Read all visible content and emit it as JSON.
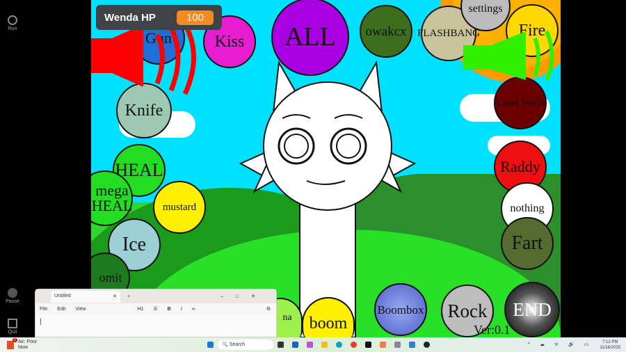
{
  "sidebar": {
    "run": "Run",
    "pause": "Pause",
    "quit": "Quit"
  },
  "hud": {
    "name": "Wenda HP",
    "hp": "100"
  },
  "buttons": [
    "Gun",
    "Kiss",
    "ALL",
    "owakcx",
    "FLASHBANG",
    "settings",
    "Fire",
    "Laser beam",
    "Knife",
    "HEAL",
    "mega HEAL",
    "mustard",
    "Ice",
    "omit",
    "Raddy",
    "nothing",
    "Fart",
    "Boombox",
    "Rock",
    "END",
    "boom",
    "na"
  ],
  "footer_text": "Ver:0.1",
  "notepad": {
    "tab": "Untitled",
    "menu": [
      "File",
      "Edit",
      "View"
    ],
    "heading": "H1"
  },
  "taskbar": {
    "weather": "Air: Poor",
    "weather_sub": "Now",
    "badge": "2",
    "search": "Search",
    "time": "7:12 PM",
    "date": "11/16/2025"
  }
}
